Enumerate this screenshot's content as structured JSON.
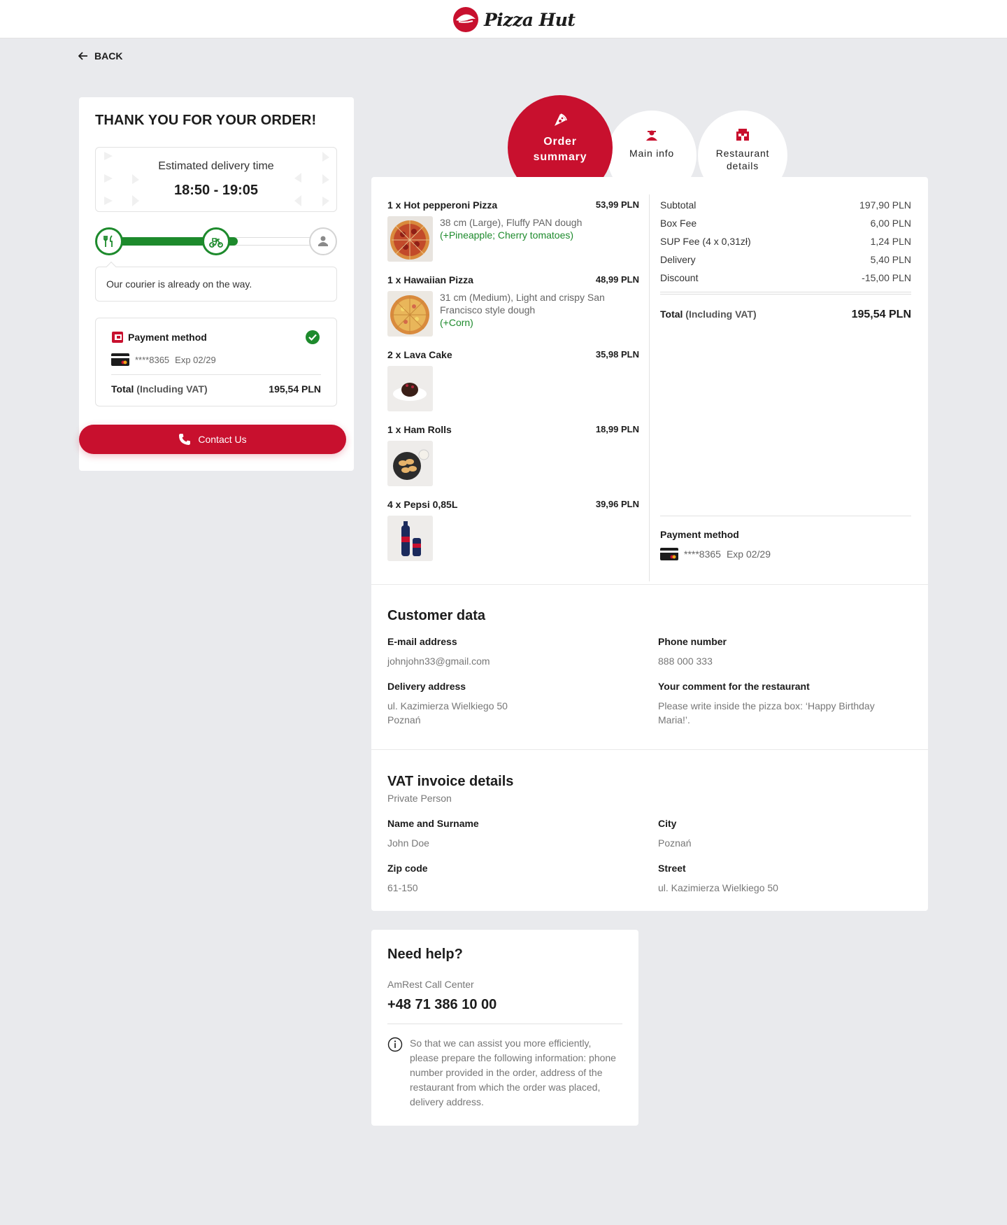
{
  "header": {
    "brand": "Pizza Hut"
  },
  "nav": {
    "back_label": "BACK"
  },
  "order_status": {
    "title": "THANK YOU FOR YOUR ORDER!",
    "eta_label": "Estimated delivery time",
    "eta_time": "18:50 - 19:05",
    "progress_fraction": 0.6,
    "status_message": "Our courier is already on the way.",
    "payment": {
      "title": "Payment method",
      "card_masked": "****8365",
      "card_exp": "Exp 02/29",
      "total_label": "Total",
      "total_suffix": "(Including VAT)",
      "total_value": "195,54 PLN"
    },
    "contact_label": "Contact Us"
  },
  "tabs": [
    {
      "label": "Order summary",
      "icon": "pizza-slice-icon",
      "active": true
    },
    {
      "label": "Main info",
      "icon": "delivery-person-icon",
      "active": false
    },
    {
      "label": "Restaurant details",
      "icon": "restaurant-icon",
      "active": false
    }
  ],
  "order_items": [
    {
      "title": "1 x Hot pepperoni Pizza",
      "price": "53,99 PLN",
      "desc": "38 cm (Large), Fluffy PAN dough",
      "extras": "(+Pineapple; Cherry tomatoes)",
      "image": "pepperoni-pizza-image"
    },
    {
      "title": "1 x Hawaiian Pizza",
      "price": "48,99 PLN",
      "desc": "31 cm (Medium), Light and crispy San Francisco style dough",
      "extras": "(+Corn)",
      "image": "hawaiian-pizza-image"
    },
    {
      "title": "2 x Lava Cake",
      "price": "35,98 PLN",
      "desc": "",
      "extras": "",
      "image": "lava-cake-image"
    },
    {
      "title": "1 x Ham Rolls",
      "price": "18,99 PLN",
      "desc": "",
      "extras": "",
      "image": "ham-rolls-image"
    },
    {
      "title": "4 x Pepsi 0,85L",
      "price": "39,96 PLN",
      "desc": "",
      "extras": "",
      "image": "pepsi-image"
    }
  ],
  "summary": {
    "rows": [
      {
        "label": "Subtotal",
        "value": "197,90 PLN"
      },
      {
        "label": "Box Fee",
        "value": "6,00 PLN"
      },
      {
        "label": "SUP Fee (4 x 0,31zł)",
        "value": "1,24 PLN"
      },
      {
        "label": "Delivery",
        "value": "5,40 PLN"
      },
      {
        "label": "Discount",
        "value": "-15,00 PLN"
      }
    ],
    "total_label": "Total",
    "total_suffix": "(Including VAT)",
    "total_value": "195,54 PLN",
    "payment_title": "Payment method",
    "card_masked": "****8365",
    "card_exp": "Exp 02/29"
  },
  "customer": {
    "title": "Customer data",
    "email_label": "E-mail address",
    "email": "johnjohn33@gmail.com",
    "phone_label": "Phone number",
    "phone": "888 000 333",
    "address_label": "Delivery address",
    "address_line1": "ul. Kazimierza Wielkiego 50",
    "address_line2": "Poznań",
    "comment_label": "Your comment for the restaurant",
    "comment": "Please write inside the pizza box: ‘Happy Birthday Maria!’."
  },
  "vat": {
    "title": "VAT invoice details",
    "subtitle": "Private Person",
    "name_label": "Name and Surname",
    "name": "John Doe",
    "city_label": "City",
    "city": "Poznań",
    "zip_label": "Zip code",
    "zip": "61-150",
    "street_label": "Street",
    "street": "ul. Kazimierza Wielkiego 50"
  },
  "help": {
    "title": "Need help?",
    "center": "AmRest Call Center",
    "phone": "+48 71 386 10 00",
    "info": "So that we can assist you more efficiently, please prepare the following information: phone number provided in the order, address of the restaurant from which the order was placed, delivery address."
  },
  "colors": {
    "brand_red": "#c8102e",
    "success_green": "#1d8a2c",
    "background": "#e9eaed"
  }
}
